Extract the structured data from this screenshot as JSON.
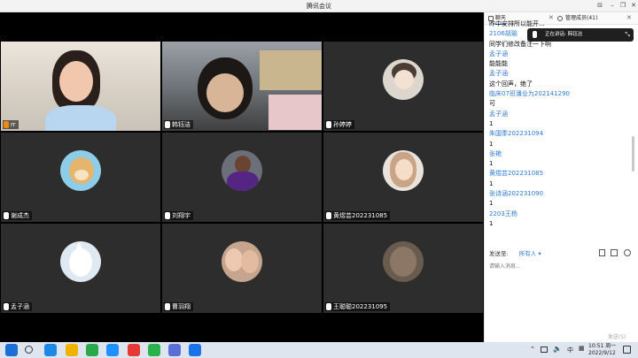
{
  "window": {
    "title": "腾讯会议",
    "minimize": "–",
    "restore": "❐",
    "close": "✕"
  },
  "participants": [
    {
      "name": "rr",
      "kind": "video-female",
      "muted": false
    },
    {
      "name": "韩钰洁",
      "kind": "video-male",
      "muted": true
    },
    {
      "name": "孙婷婷",
      "kind": "avatar-cartoon",
      "muted": true
    },
    {
      "name": "谢成杰",
      "kind": "avatar-doge",
      "muted": true
    },
    {
      "name": "刘翔宇",
      "kind": "avatar-athlete",
      "muted": true
    },
    {
      "name": "黄煜芸202231085",
      "kind": "avatar-woman",
      "muted": true
    },
    {
      "name": "孟子涵",
      "kind": "avatar-rabbit",
      "muted": true
    },
    {
      "name": "曹羽翔",
      "kind": "avatar-couple",
      "muted": true
    },
    {
      "name": "王聪聪202231095",
      "kind": "avatar-photo",
      "muted": true
    }
  ],
  "chat": {
    "tabs": {
      "chat": "聊天",
      "members": "管理成员(41)"
    },
    "speaking": "正在讲话: 韩钰洁",
    "messages": [
      {
        "type": "text",
        "value": "昨中安排所以能开..."
      },
      {
        "type": "sender",
        "value": "2106胡瑜"
      },
      {
        "type": "text",
        "value": "同学们修改备注一下啊"
      },
      {
        "type": "sender",
        "value": "孟子涵"
      },
      {
        "type": "text",
        "value": "能能能"
      },
      {
        "type": "sender",
        "value": "孟子涵"
      },
      {
        "type": "text",
        "value": "这个回声，绝了"
      },
      {
        "type": "sender",
        "value": "临床07班潘业为202141290"
      },
      {
        "type": "text",
        "value": "可"
      },
      {
        "type": "sender",
        "value": "孟子涵"
      },
      {
        "type": "text",
        "value": "1"
      },
      {
        "type": "sender",
        "value": "朱国季202231094"
      },
      {
        "type": "text",
        "value": "1"
      },
      {
        "type": "sender",
        "value": "张艳"
      },
      {
        "type": "text",
        "value": "1"
      },
      {
        "type": "sender",
        "value": "黄煜芸202231085"
      },
      {
        "type": "text",
        "value": "1"
      },
      {
        "type": "sender",
        "value": "张诗涵202231090"
      },
      {
        "type": "text",
        "value": "1"
      },
      {
        "type": "sender",
        "value": "2203王杨"
      },
      {
        "type": "text",
        "value": "1"
      }
    ],
    "send_to_label": "发送至:",
    "send_to_value": "所有人",
    "input_placeholder": "请输入消息...",
    "send_button": "发送(S)"
  },
  "taskbar": {
    "time": "10:51 周一",
    "date": "2022/9/12",
    "ime": "中",
    "apps": [
      "start-icon",
      "search-icon",
      "edge-icon",
      "explorer-icon",
      "wechat-work-icon",
      "qq-icon",
      "wps-icon",
      "wechat-icon",
      "people-icon",
      "meeting-icon"
    ]
  },
  "colors": {
    "sender": "#2c7ad6",
    "tile": "#2d2d2d",
    "stage": "#000000",
    "speakingBg": "#1f1f1f"
  }
}
